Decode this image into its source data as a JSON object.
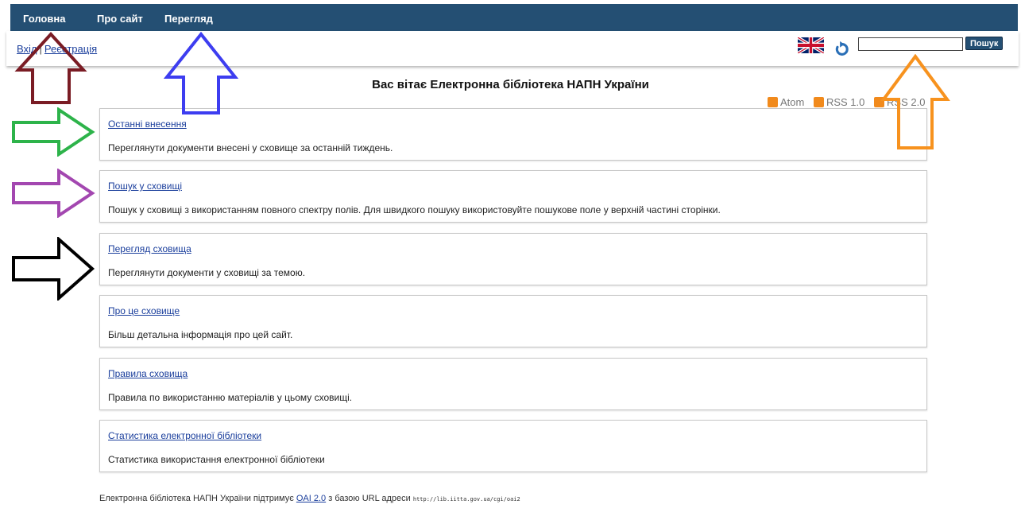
{
  "nav": {
    "items": [
      "Головна",
      "Про сайт",
      "Перегляд"
    ]
  },
  "auth": {
    "login": "Вхід",
    "separator": "|",
    "register": "Реєстрація"
  },
  "search": {
    "button_label": "Пошук",
    "value": ""
  },
  "page_title": "Вас вітає Електронна бібліотека НАПН України",
  "feeds": [
    "Atom",
    "RSS 1.0",
    "RSS 2.0"
  ],
  "cards": [
    {
      "title": "Останні внесення",
      "description": "Переглянути документи внесені у сховище за останній тиждень."
    },
    {
      "title": "Пошук у сховищі",
      "description": "Пошук у сховищі з використанням повного спектру полів. Для швидкого пошуку використовуйте пошукове поле у верхній частині сторінки."
    },
    {
      "title": "Перегляд сховища",
      "description": "Переглянути документи у сховищі за темою."
    },
    {
      "title": "Про це сховище",
      "description": "Більш детальна інформація про цей сайт."
    },
    {
      "title": "Правила сховища",
      "description": "Правила по використанню матеріалів у цьому сховищі."
    },
    {
      "title": "Статистика електронної бібліотеки",
      "description": "Статистика використання електронної бібліотеки"
    }
  ],
  "footer": {
    "prefix": "Електронна бібліотека НАПН України підтримує",
    "oai_link": "OAI 2.0",
    "middle": "з базою URL адреси",
    "url": "http://lib.iitta.gov.ua/cgi/oai2"
  },
  "annotation_colors": {
    "dark_red": "#7a1c24",
    "blue": "#3d3df0",
    "orange": "#f7921e",
    "green": "#2db34a",
    "purple": "#a347b0",
    "black": "#000000"
  },
  "icons": [
    "uk-flag-icon",
    "refresh-icon",
    "rss-icon"
  ]
}
